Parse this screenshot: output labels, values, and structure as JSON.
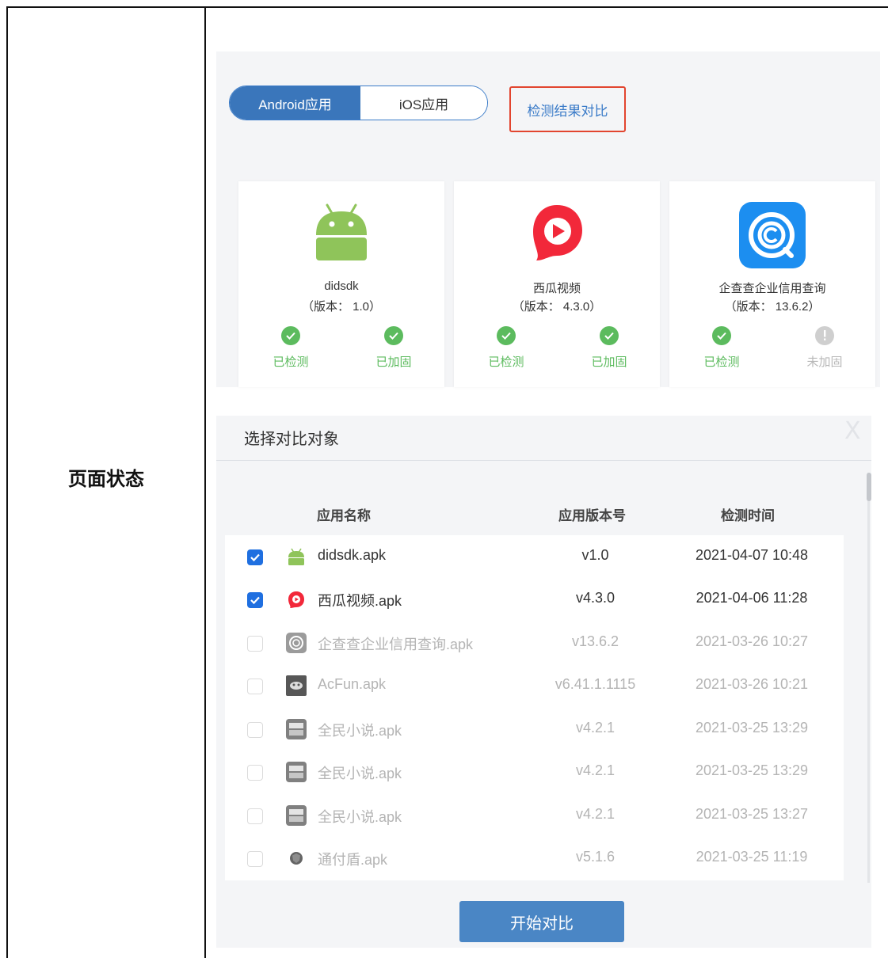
{
  "doc": {
    "row_label": "页面状态"
  },
  "top": {
    "tabs": [
      {
        "label": "Android应用",
        "active": true
      },
      {
        "label": "iOS应用",
        "active": false
      }
    ],
    "compare_link": "检测结果对比",
    "cards": [
      {
        "name": "didsdk",
        "version": "（版本：  1.0）",
        "icon": "android-icon",
        "status_left": {
          "label": "已检测",
          "state": "done"
        },
        "status_right": {
          "label": "已加固",
          "state": "done"
        }
      },
      {
        "name": "西瓜视频",
        "version": "（版本：  4.3.0）",
        "icon": "xigua-video-icon",
        "status_left": {
          "label": "已检测",
          "state": "done"
        },
        "status_right": {
          "label": "已加固",
          "state": "done"
        }
      },
      {
        "name": "企查查企业信用查询",
        "version": "（版本：  13.6.2）",
        "icon": "qichacha-icon",
        "status_left": {
          "label": "已检测",
          "state": "done"
        },
        "status_right": {
          "label": "未加固",
          "state": "pending"
        }
      }
    ],
    "colors": {
      "accent": "#3a76bb",
      "success": "#5cbb5e",
      "highlight": "#e2452f"
    }
  },
  "modal": {
    "title": "选择对比对象",
    "close": "X",
    "columns": {
      "name": "应用名称",
      "version": "应用版本号",
      "time": "检测时间"
    },
    "rows": [
      {
        "checked": true,
        "enabled": true,
        "icon": "android-icon",
        "name": "didsdk.apk",
        "version": "v1.0",
        "time": "2021-04-07 10:48"
      },
      {
        "checked": true,
        "enabled": true,
        "icon": "xigua-video-icon",
        "name": "西瓜视频.apk",
        "version": "v4.3.0",
        "time": "2021-04-06 11:28"
      },
      {
        "checked": false,
        "enabled": false,
        "icon": "qichacha-icon",
        "name": "企查查企业信用查询.apk",
        "version": "v13.6.2",
        "time": "2021-03-26 10:27"
      },
      {
        "checked": false,
        "enabled": false,
        "icon": "acfun-icon",
        "name": "AcFun.apk",
        "version": "v6.41.1.1115",
        "time": "2021-03-26 10:21"
      },
      {
        "checked": false,
        "enabled": false,
        "icon": "novel-icon",
        "name": "全民小说.apk",
        "version": "v4.2.1",
        "time": "2021-03-25 13:29"
      },
      {
        "checked": false,
        "enabled": false,
        "icon": "novel-icon",
        "name": "全民小说.apk",
        "version": "v4.2.1",
        "time": "2021-03-25 13:29"
      },
      {
        "checked": false,
        "enabled": false,
        "icon": "novel-icon",
        "name": "全民小说.apk",
        "version": "v4.2.1",
        "time": "2021-03-25 13:27"
      },
      {
        "checked": false,
        "enabled": false,
        "icon": "shield-app-icon",
        "name": "通付盾.apk",
        "version": "v5.1.6",
        "time": "2021-03-25 11:19"
      }
    ],
    "start_button": "开始对比"
  }
}
